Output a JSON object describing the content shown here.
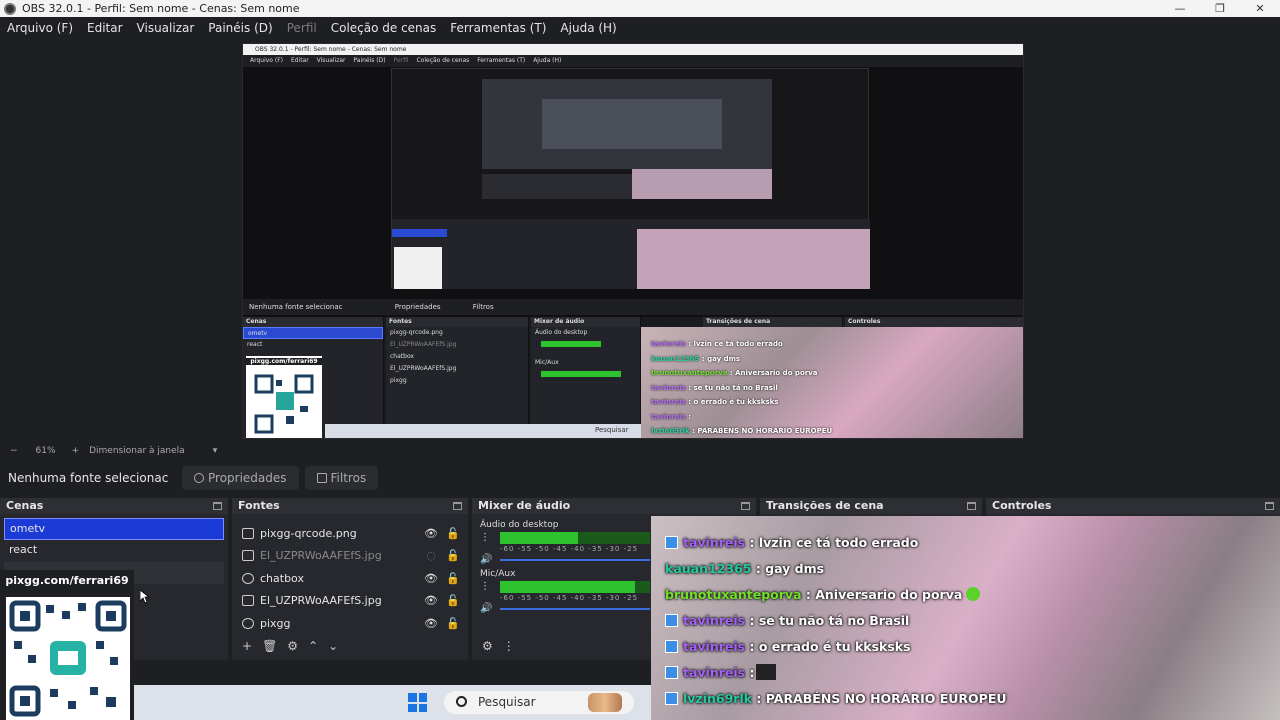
{
  "window": {
    "title": "OBS 32.0.1 - Perfil: Sem nome - Cenas: Sem nome",
    "minimize": "—",
    "maximize": "❐",
    "close": "✕"
  },
  "menu": [
    "Arquivo (F)",
    "Editar",
    "Visualizar",
    "Painéis (D)",
    "Perfil",
    "Coleção de cenas",
    "Ferramentas (T)",
    "Ajuda (H)"
  ],
  "preview": {
    "title": "OBS 32.0.1 - Perfil: Sem nome - Cenas: Sem nome",
    "menu": [
      "Arquivo (F)",
      "Editar",
      "Visualizar",
      "Painéis (D)",
      "Perfil",
      "Coleção de cenas",
      "Ferramentas (T)",
      "Ajuda (H)"
    ],
    "status": "Nenhuma fonte selecionac",
    "props": "Propriedades",
    "filters": "Filtros",
    "docks": [
      "Cenas",
      "Fontes",
      "Mixer de áudio",
      "Transições de cena",
      "Controles"
    ],
    "scenes": [
      "ometv",
      "react"
    ],
    "sources": [
      "pixgg-qrcode.png",
      "El_UZPRWoAAFEfS.jpg",
      "chatbox",
      "El_UZPRWoAAFEfS.jpg",
      "pixgg"
    ],
    "audio": [
      "Áudio do desktop",
      "Mic/Aux"
    ],
    "qr_label": "pixgg.com/ferrari69",
    "search": "Pesquisar",
    "chat": [
      {
        "user": "tavinreis",
        "msg": ": lvzin ce tá todo errado",
        "ucls": "u1"
      },
      {
        "user": "kauan12365",
        "msg": ": gay dms",
        "ucls": "u2"
      },
      {
        "user": "brunotuxanteporva",
        "msg": ": Aniversario do porva",
        "ucls": "u3"
      },
      {
        "user": "tavinreis",
        "msg": ": se tu não tá no Brasil",
        "ucls": "u1"
      },
      {
        "user": "tavinreis",
        "msg": ": o errado é tu kksksks",
        "ucls": "u1"
      },
      {
        "user": "tavinreis",
        "msg": ":",
        "ucls": "u1"
      },
      {
        "user": "lvzin69rlk",
        "msg": ": PARABÉNS NO HORÁRIO EUROPEU",
        "ucls": "u2"
      }
    ]
  },
  "zoom": {
    "minus": "−",
    "value": "61%",
    "plus": "+",
    "mode": "Dimensionar à janela",
    "arrow": "▾"
  },
  "source_toolbar": {
    "status": "Nenhuma fonte selecionac",
    "properties": "Propriedades",
    "filters": "Filtros"
  },
  "scenes": {
    "title": "Cenas",
    "items": [
      "ometv",
      "react"
    ]
  },
  "sources": {
    "title": "Fontes",
    "items": [
      {
        "name": "pixgg-qrcode.png",
        "visible": true
      },
      {
        "name": "El_UZPRWoAAFEfS.jpg",
        "visible": false
      },
      {
        "name": "chatbox",
        "visible": true
      },
      {
        "name": "El_UZPRWoAAFEfS.jpg",
        "visible": true
      },
      {
        "name": "pixgg",
        "visible": true
      }
    ],
    "footer": [
      "+",
      "🗑",
      "⚙",
      "⌃",
      "⌄"
    ]
  },
  "mixer": {
    "title": "Mixer de áudio",
    "channels": [
      {
        "name": "Áudio do desktop",
        "level": 0.52
      },
      {
        "name": "Mic/Aux",
        "level": 0.9
      }
    ],
    "ticks": "-60 -55 -50 -45 -40 -35 -30 -25",
    "footer": [
      "⚙",
      "⋮"
    ]
  },
  "transitions": {
    "title": "Transições de cena"
  },
  "controls": {
    "title": "Controles"
  },
  "chat_overlay": {
    "lines": [
      {
        "user": "tavinreis",
        "msg": ": lvzin ce tá todo errado",
        "color": "purple",
        "badge": true
      },
      {
        "user": "kauan12365",
        "msg": ": gay dms",
        "color": "teal",
        "badge": false
      },
      {
        "user": "brunotuxanteporva",
        "msg": ": Aniversario do porva",
        "color": "green",
        "badge": false,
        "emote": true
      },
      {
        "user": "tavinreis",
        "msg": ": se tu não tá no Brasil",
        "color": "purple",
        "badge": true
      },
      {
        "user": "tavinreis",
        "msg": ": o errado é tu kksksks",
        "color": "purple",
        "badge": true
      },
      {
        "user": "tavinreis",
        "msg": ":",
        "color": "purple",
        "badge": true,
        "emote2": true
      },
      {
        "user": "lvzin69rlk",
        "msg": ": PARABÉNS NO HORÁRIO EUROPEU",
        "color": "teal",
        "badge": true
      }
    ]
  },
  "qr": {
    "label": "pixgg.com/ferrari69"
  },
  "taskbar": {
    "search": "Pesquisar"
  },
  "colors": {
    "accent": "#1c3ad6",
    "meter_green": "#2fc22f",
    "bg": "#1e1f23"
  }
}
